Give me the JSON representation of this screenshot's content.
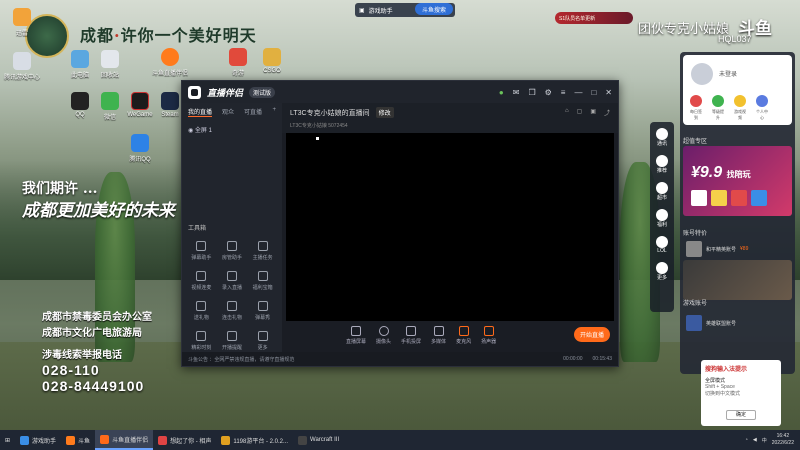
{
  "wallpaper": {
    "title_a": "成都",
    "title_b": "许你一个美好明天",
    "slogan1": "我们期许 ...",
    "slogan2": "成都更加美好的未来",
    "org1": "成都市禁毒委员会办公室",
    "org2": "成都市文化广电旅游局",
    "report": "涉毒线索举报电话",
    "hotline1": "028-110",
    "hotline2": "028-84449100"
  },
  "desktop_icons": [
    {
      "label": "迅雷",
      "color": "#f2a33a"
    },
    {
      "label": "腾讯游戏中心",
      "color": "#d8dde5"
    },
    {
      "label": "此电脑",
      "color": "#5aa7e0"
    },
    {
      "label": "回收站",
      "color": "#e3e7ec"
    },
    {
      "label": "微信",
      "color": "#3fb34f"
    },
    {
      "label": "WeGame",
      "color": "#1c1c1c"
    },
    {
      "label": "Steam",
      "color": "#1c2a45"
    },
    {
      "label": "QQ",
      "color": "#222"
    },
    {
      "label": "斗鱼直播伴侣",
      "color": "#ff7b1c"
    },
    {
      "label": "奇游",
      "color": "#e14a3b"
    },
    {
      "label": "CSGO",
      "color": "#e1b040"
    },
    {
      "label": "腾讯QQ",
      "color": "#2d82e6"
    }
  ],
  "topbar": {
    "label": "游戏助手",
    "search": "斗鱼搜索"
  },
  "app": {
    "name": "直播伴侣",
    "version": "测试版",
    "tabs": [
      "我的直播",
      "观众",
      "可直播"
    ],
    "scene": "全屏 1",
    "room_title": "LT3C专克小姑娘的直播间",
    "room_tag": "修改",
    "room_meta": "LT3C专克小姑娘 5072454",
    "tools_title": "工具箱",
    "tools": [
      "弹幕助手",
      "房管助手",
      "主播任务",
      "视频连麦",
      "录入直播",
      "福利宝箱",
      "送礼物",
      "连击礼物",
      "弹幕秀",
      "精彩时刻",
      "开播提醒",
      "更多"
    ],
    "toolbar": [
      "直播屏幕",
      "摄像头",
      "手机投屏",
      "多媒体",
      "麦克风",
      "扬声器"
    ],
    "go_live": "开始直播",
    "status": "斗鱼公告 ：全网严禁违规直播，请遵守直播规范",
    "timer": "00:00:00",
    "time_right": "00:15:43"
  },
  "dock": [
    "通讯",
    "推荐",
    "超市",
    "福利",
    "LOL",
    "更多"
  ],
  "right_panel": {
    "login": "未登录",
    "quick": [
      "每日签到",
      "等级提升",
      "游戏视频",
      "个人中心"
    ],
    "sec1": "超值专区",
    "promo_price": "¥9.9",
    "promo_text": "找陪玩",
    "sec2": "账号特价",
    "item1": "和平精英账号",
    "item1_price": "¥89",
    "sec3": "游戏账号",
    "item2": "英雄联盟账号"
  },
  "ime": {
    "title": "搜狗输入法提示",
    "line1": "全屏模式",
    "line2": "Shift + Space",
    "line3": "切换到中文模式",
    "button": "确定"
  },
  "overlay": {
    "promo": "S1队员名单更新",
    "watermark": "团伙专克小姑娘",
    "logo": "斗鱼",
    "id": "HQL037"
  },
  "taskbar": {
    "items": [
      {
        "label": "游戏助手",
        "color": "#3a8ee6",
        "active": false
      },
      {
        "label": "斗鱼",
        "color": "#ff7b1c",
        "active": false
      },
      {
        "label": "斗鱼直播伴侣",
        "color": "#ff6a1a",
        "active": true
      },
      {
        "label": "想起了你 - 相声",
        "color": "#e04444",
        "active": false
      },
      {
        "label": "1198游平台 - 2.0.2...",
        "color": "#e0a020",
        "active": false
      },
      {
        "label": "Warcraft III",
        "color": "#444",
        "active": false
      }
    ],
    "time": "16:42",
    "date": "2022/6/22"
  }
}
